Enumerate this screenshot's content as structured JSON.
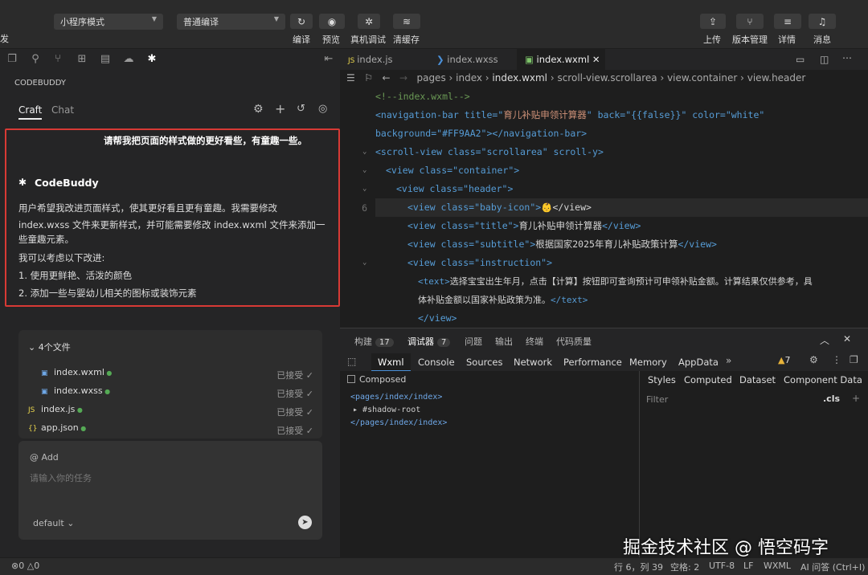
{
  "toolbar": {
    "left_cut": "发",
    "mode_select": "小程序模式",
    "compile_select": "普通编译",
    "compile": "编译",
    "preview": "预览",
    "device_debug": "真机调试",
    "clear_cache": "清缓存",
    "upload": "上传",
    "version": "版本管理",
    "detail": "详情",
    "message": "消息"
  },
  "panel": {
    "title": "CODEBUDDY",
    "tab_craft": "Craft",
    "tab_chat": "Chat",
    "user_msg": "请帮我把页面的样式做的更好看些，有童趣一些。",
    "bot_name": "CodeBuddy",
    "bot_lines": [
      "用户希望我改进页面样式，使其更好看且更有童趣。我需要修改",
      "index.wxss 文件来更新样式，并可能需要修改 index.wxml 文件来添加一",
      "些童趣元素。",
      "我可以考虑以下改进:",
      "1. 使用更鲜艳、活泼的颜色",
      "2. 添加一些与婴幼儿相关的图标或装饰元素"
    ],
    "files_header": "4个文件",
    "files": [
      {
        "icon": "wxml",
        "name": "index.wxml",
        "status": "已接受"
      },
      {
        "icon": "wxss",
        "name": "index.wxss",
        "status": "已接受"
      },
      {
        "icon": "JS",
        "name": "index.js",
        "status": "已接受"
      },
      {
        "icon": "{}",
        "name": "app.json",
        "status": "已接受"
      }
    ],
    "add": "@ Add",
    "placeholder": "请输入你的任务",
    "model": "default"
  },
  "tabs": [
    {
      "label": "index.js"
    },
    {
      "label": "index.wxss"
    },
    {
      "label": "index.wxml"
    }
  ],
  "breadcrumb": [
    "pages",
    "index",
    "index.wxml",
    "scroll-view.scrollarea",
    "view.container",
    "view.header"
  ],
  "code": {
    "l1": "<!--index.wxml-->",
    "l2a": "<navigation-bar title=\"",
    "l2t": "育儿补贴申领计算器",
    "l2b": "\" back=\"{{false}}\" color=\"white\"",
    "l3": "background=\"#FF9AA2\"></navigation-bar>",
    "l4": "<scroll-view class=\"scrollarea\" scroll-y>",
    "l5": "<view class=\"container\">",
    "l6": "<view class=\"header\">",
    "l7num": "6",
    "l7": "<view class=\"baby-icon\">",
    "l7e": "👶</view>",
    "l8a": "<view class=\"title\">",
    "l8t": "育儿补贴申领计算器",
    "l8b": "</view>",
    "l9a": "<view class=\"subtitle\">",
    "l9t": "根据国家2025年育儿补贴政策计算",
    "l9b": "</view>",
    "l10": "<view class=\"instruction\">",
    "l11a": "<text>",
    "l11t": "选择宝宝出生年月，点击【计算】按钮即可查询预计可申领补贴金额。计算结果仅供参考，具",
    "l12t": "体补贴金额以国家补贴政策为准。",
    "l12b": "</text>",
    "l13": "</view>"
  },
  "dev": {
    "build": "构建",
    "build_count": "17",
    "debug": "调试器",
    "debug_count": "7",
    "issues": "问题",
    "output": "输出",
    "terminal": "终端",
    "quality": "代码质量",
    "tabs": [
      "Wxml",
      "Console",
      "Sources",
      "Network",
      "Performance",
      "Memory",
      "AppData"
    ],
    "warn_count": "7",
    "composed": "Composed",
    "right_tabs": [
      "Styles",
      "Computed",
      "Dataset",
      "Component Data"
    ],
    "filter": "Filter",
    "cls": ".cls",
    "tree": [
      "<pages/index/index>",
      "#shadow-root",
      "</pages/index/index>"
    ]
  },
  "status": {
    "errors": "0",
    "warnings": "0",
    "pos": "行 6，列 39",
    "spaces": "空格: 2",
    "enc": "UTF-8",
    "eol": "LF",
    "lang": "WXML",
    "ai": "AI 问答 (Ctrl+I)"
  },
  "watermark": "掘金技术社区 @ 悟空码字"
}
